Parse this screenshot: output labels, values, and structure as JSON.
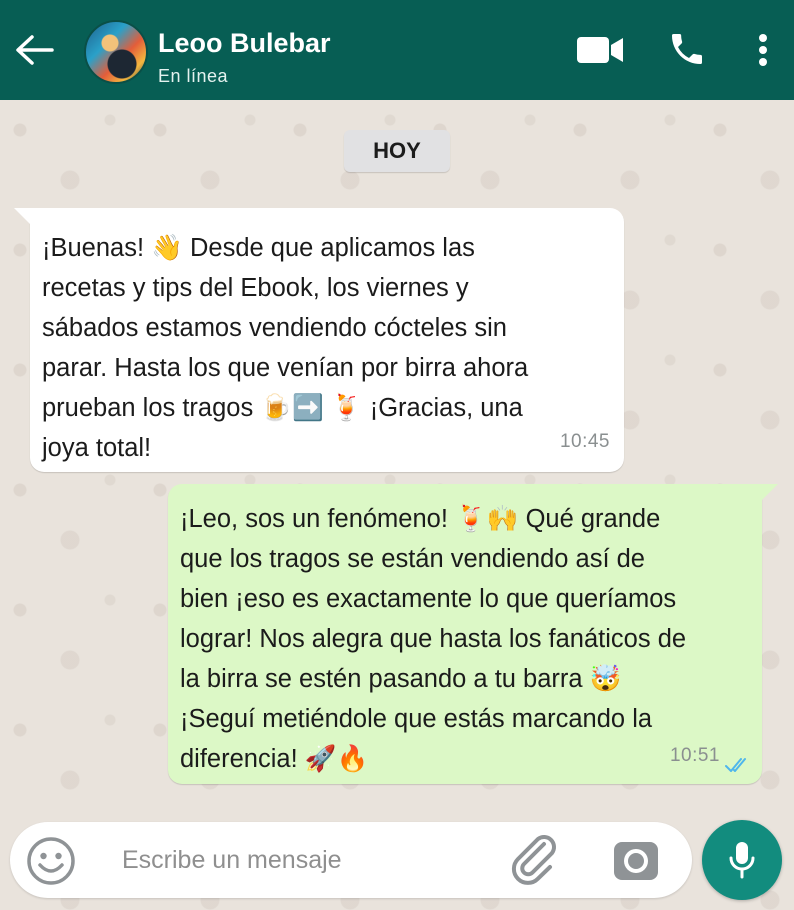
{
  "header": {
    "contact_name": "Leoo Bulebar",
    "status": "En línea",
    "background": "#075e54"
  },
  "chat": {
    "date_label": "HOY",
    "messages": [
      {
        "direction": "incoming",
        "lines": [
          "¡Buenas! 👋 Desde que aplicamos las",
          "recetas y tips del Ebook, los viernes y",
          "sábados estamos vendiendo cócteles sin",
          "parar. Hasta los que venían por birra ahora",
          "prueban los tragos 🍺➡️ 🍹 ¡Gracias, una",
          "joya total!"
        ],
        "time": "10:45"
      },
      {
        "direction": "outgoing",
        "lines": [
          "¡Leo, sos un fenómeno! 🍹🙌 Qué grande",
          "que los tragos se están vendiendo así de",
          "bien ¡eso es exactamente lo que queríamos",
          "lograr! Nos alegra que hasta los fanáticos de",
          "la birra se estén pasando a tu barra 🤯",
          "¡Seguí metiéndole que estás marcando la",
          "diferencia! 🚀🔥"
        ],
        "time": "10:51",
        "status": "read"
      }
    ]
  },
  "composer": {
    "placeholder": "Escribe un mensaje",
    "value": ""
  },
  "colors": {
    "accent": "#128c7e",
    "outgoing_bubble": "#dcf8c6",
    "read_ticks": "#4fb6ec"
  },
  "icons": {
    "back": "arrow-left-icon",
    "video": "video-camera-icon",
    "call": "phone-icon",
    "menu": "more-vertical-icon",
    "emoji": "smiley-icon",
    "attach": "paperclip-icon",
    "camera": "camera-icon",
    "mic": "microphone-icon"
  }
}
